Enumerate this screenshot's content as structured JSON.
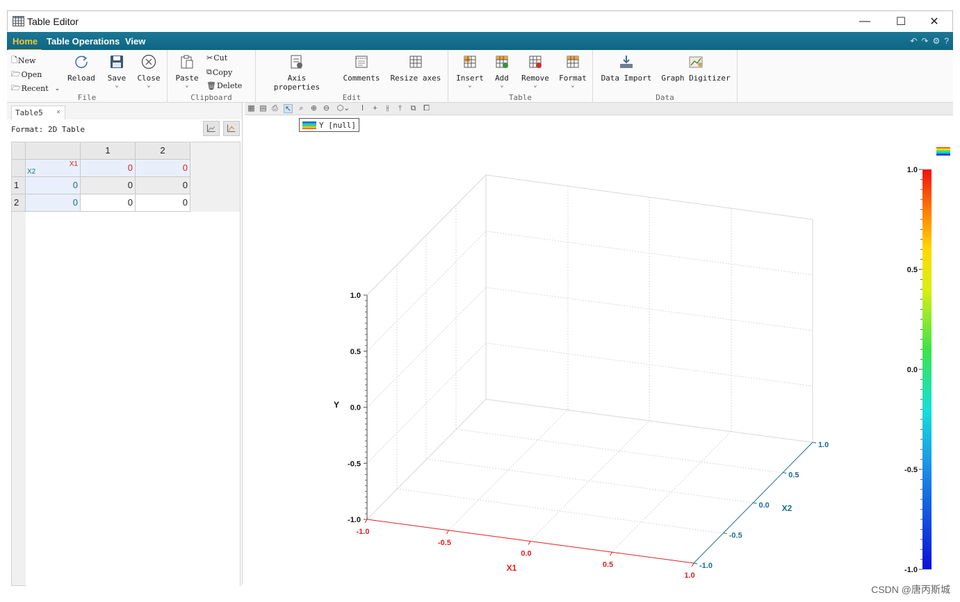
{
  "window": {
    "title": "Table Editor",
    "controls": {
      "minimize": "—",
      "maximize": "☐",
      "close": "✕"
    }
  },
  "menu": {
    "items": [
      "Home",
      "Table Operations",
      "View"
    ],
    "active": "Home"
  },
  "ribbon": {
    "file": {
      "label": "File",
      "new": "New",
      "open": "Open",
      "recent": "Recent",
      "reload": "Reload",
      "save": "Save",
      "close": "Close"
    },
    "clipboard": {
      "label": "Clipboard",
      "paste": "Paste",
      "cut": "Cut",
      "copy": "Copy",
      "delete": "Delete"
    },
    "edit": {
      "label": "Edit",
      "axis_properties": "Axis properties",
      "comments": "Comments",
      "resize_axes": "Resize axes"
    },
    "table": {
      "label": "Table",
      "insert": "Insert",
      "add": "Add",
      "remove": "Remove",
      "format": "Format"
    },
    "data": {
      "label": "Data",
      "data_import": "Data Import",
      "graph_digitizer": "Graph Digitizer"
    }
  },
  "left_panel": {
    "tab": "Table5",
    "tab_close": "×",
    "format": "Format: 2D Table",
    "table": {
      "col_headers": [
        "1",
        "2"
      ],
      "row_headers": [
        "1",
        "2"
      ],
      "corner_x1": "X1",
      "corner_x2": "X2",
      "x1_values": [
        "0",
        "0"
      ],
      "x2_values": [
        "0",
        "0"
      ],
      "values": [
        [
          "0",
          "0"
        ],
        [
          "0",
          "0"
        ]
      ]
    }
  },
  "graph": {
    "legend_label": "Y [null]",
    "axis_colors": {
      "x1": "#e02020",
      "x2": "#1a6e8e",
      "y": "#111111"
    },
    "x1_label": "X1",
    "x2_label": "X2",
    "y_label": "Y",
    "y_ticks": [
      "1.0",
      "0.5",
      "0.0",
      "-0.5",
      "-1.0"
    ],
    "x1_ticks": [
      "-1.0",
      "-0.5",
      "0.0",
      "0.5",
      "1.0"
    ],
    "x2_ticks": [
      "1.0",
      "0.5",
      "0.0",
      "-0.5",
      "-1.0"
    ],
    "colorbar_ticks": [
      "1.0",
      "0.5",
      "0.0",
      "-0.5",
      "-1.0"
    ]
  },
  "watermark": "CSDN @唐丙斯城"
}
